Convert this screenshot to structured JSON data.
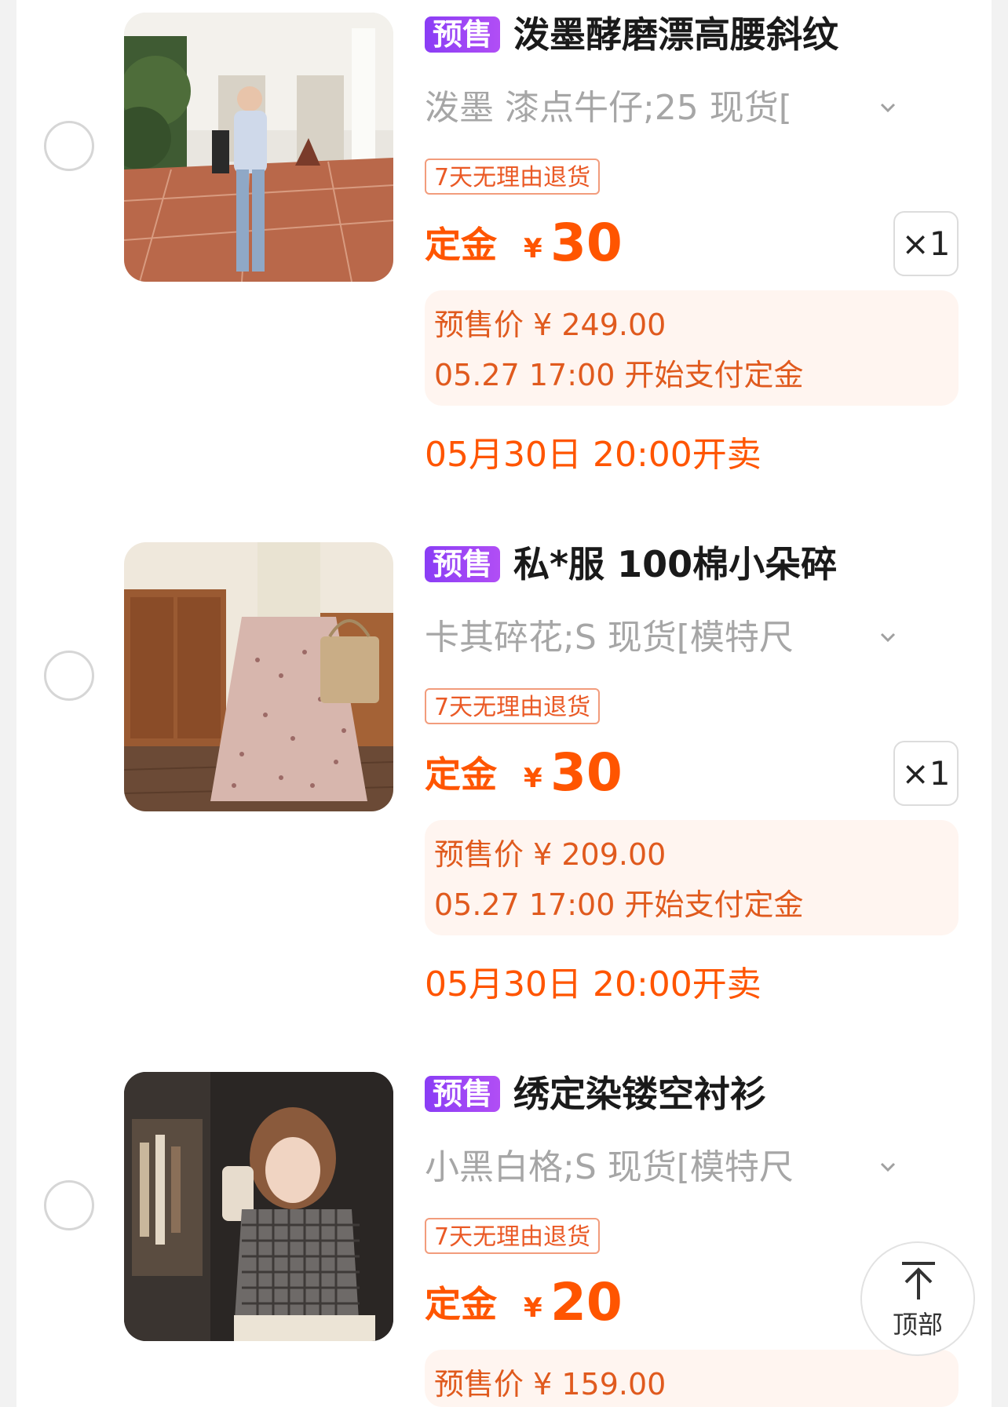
{
  "colors": {
    "accent": "#ff5500",
    "badge": "#8a3df5",
    "tag_border": "#f29c7c",
    "info_bg": "#fff5f0"
  },
  "items": [
    {
      "badge": "预售",
      "title": "泼墨酵磨漂高腰斜纹",
      "sku": "泼墨 漆点牛仔;25 现货[",
      "tag": "7天无理由退货",
      "deposit_label": "定金",
      "currency": "¥",
      "deposit": "30",
      "qty": "×1",
      "presale_price": "预售价 ¥ 249.00",
      "pay_time": "05.27 17:00 开始支付定金",
      "sale_time": "05月30日 20:00开卖"
    },
    {
      "badge": "预售",
      "title": "私*服 100棉小朵碎",
      "sku": "卡其碎花;S 现货[模特尺",
      "tag": "7天无理由退货",
      "deposit_label": "定金",
      "currency": "¥",
      "deposit": "30",
      "qty": "×1",
      "presale_price": "预售价 ¥ 209.00",
      "pay_time": "05.27 17:00 开始支付定金",
      "sale_time": "05月30日 20:00开卖"
    },
    {
      "badge": "预售",
      "title": "绣定染镂空衬衫",
      "sku": "小黑白格;S 现货[模特尺",
      "tag": "7天无理由退货",
      "deposit_label": "定金",
      "currency": "¥",
      "deposit": "20",
      "presale_price": "预售价 ¥ 159.00"
    }
  ],
  "back_to_top": {
    "label": "顶部",
    "icon": "arrow-up-to-top-icon"
  }
}
